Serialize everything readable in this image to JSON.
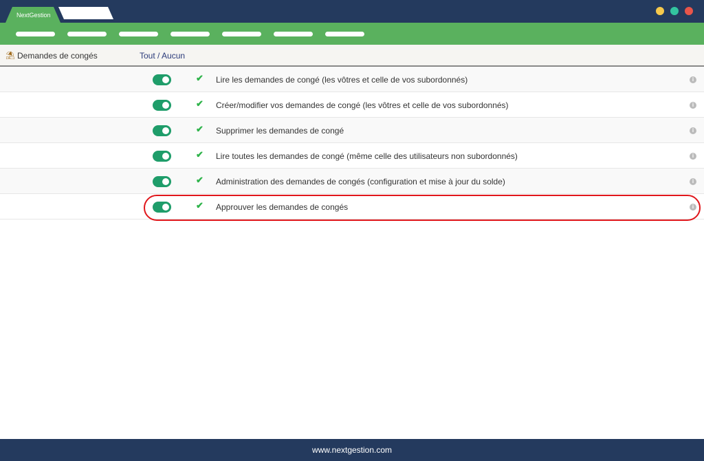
{
  "window": {
    "tab_active": "NextGestion",
    "dots": [
      "#f6c94c",
      "#33c4a0",
      "#e8554a"
    ]
  },
  "header": {
    "title": "Demandes de congés",
    "icon": "beach-umbrella-icon",
    "toggle_all": "Tout / Aucun"
  },
  "permissions": [
    {
      "label": "Lire les demandes de congé (les vôtres et celle de vos subordonnés)",
      "enabled": true
    },
    {
      "label": "Créer/modifier vos demandes de congé (les vôtres et celle de vos subordonnés)",
      "enabled": true
    },
    {
      "label": "Supprimer les demandes de congé",
      "enabled": true
    },
    {
      "label": "Lire toutes les demandes de congé (même celle des utilisateurs non subordonnés)",
      "enabled": true
    },
    {
      "label": "Administration des demandes de congés (configuration et mise à jour du solde)",
      "enabled": true
    },
    {
      "label": "Approuver les demandes de congés",
      "enabled": true
    }
  ],
  "footer": {
    "url": "www.nextgestion.com"
  }
}
